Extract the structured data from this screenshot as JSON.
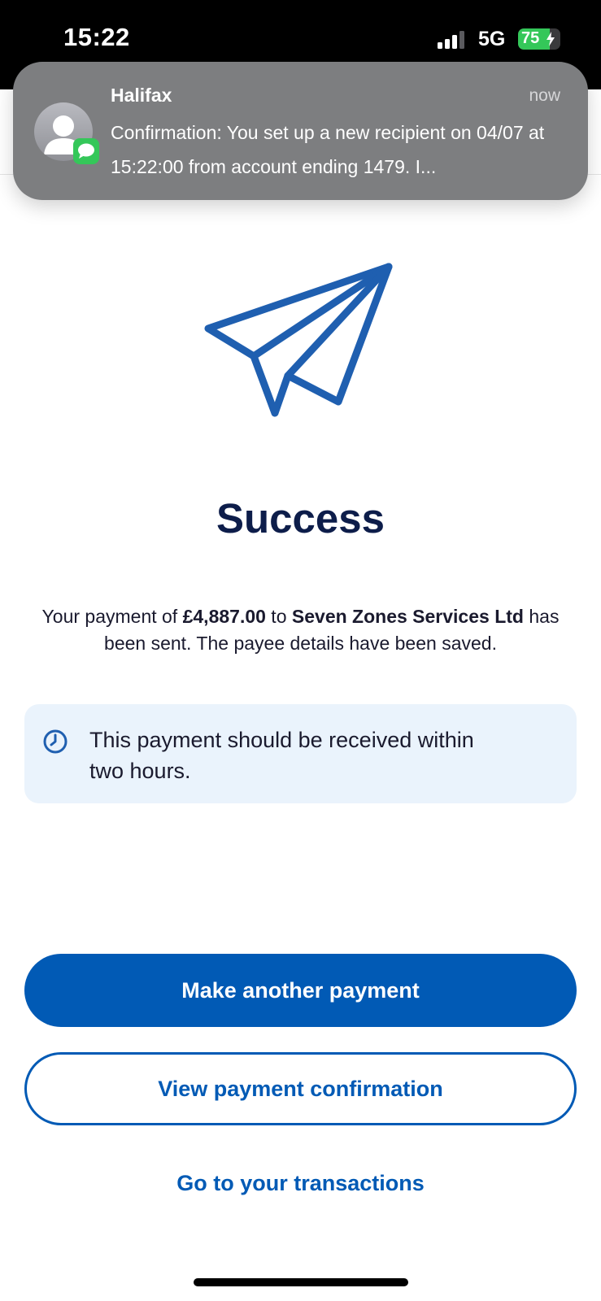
{
  "status_bar": {
    "time": "15:22",
    "network": "5G",
    "battery_level": "75",
    "battery_fill_percent": 75,
    "signal_bars_active": 3
  },
  "notification": {
    "sender": "Halifax",
    "time": "now",
    "body": "Confirmation: You set up a new recipient on 04/07 at 15:22:00 from account ending 1479. I...",
    "app_icon": "messages-icon"
  },
  "main": {
    "title": "Success",
    "message": {
      "prefix": "Your payment of ",
      "amount": "£4,887.00",
      "middle": " to ",
      "payee": "Seven Zones Services Ltd",
      "suffix": " has been sent. The payee details have been saved."
    },
    "info": {
      "icon": "clock-icon",
      "text": "This payment should be received within two hours."
    }
  },
  "actions": {
    "make_another_payment": "Make another payment",
    "view_confirmation": "View payment confirmation",
    "go_to_transactions": "Go to your transactions"
  },
  "colors": {
    "primary": "#015ab5",
    "title": "#0d1d4a",
    "info_bg": "#eaf3fc",
    "notification_bg": "#7d7e80",
    "battery": "#34c759"
  }
}
